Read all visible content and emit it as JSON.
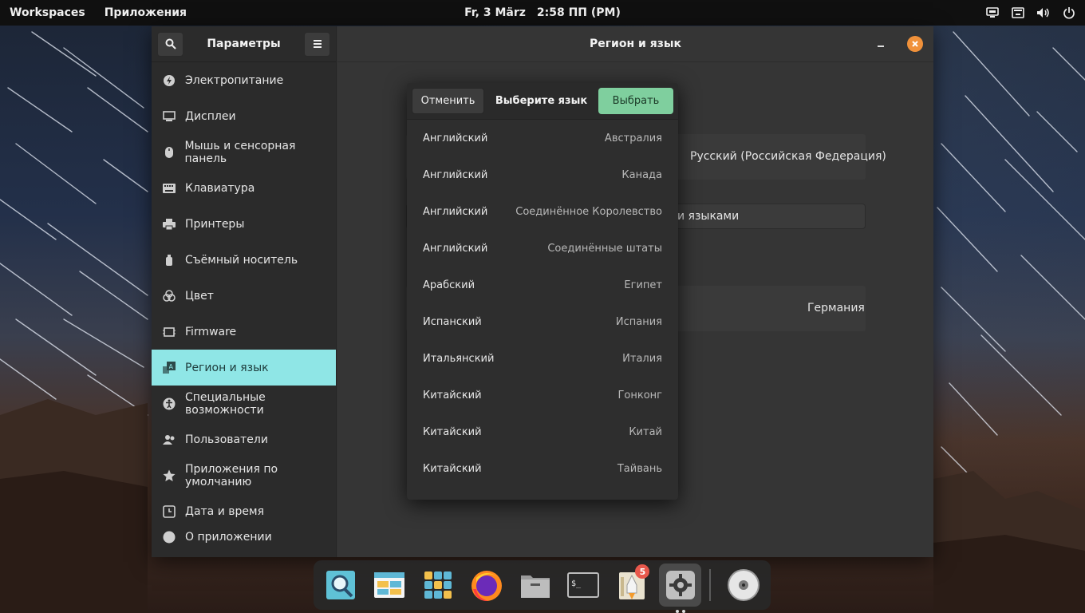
{
  "topbar": {
    "workspaces": "Workspaces",
    "applications": "Приложения",
    "date": "Fr, 3 März",
    "time": "2:58 ПП (PM)",
    "tray_icons": [
      "screen-share-icon",
      "keyboard-icon",
      "volume-icon",
      "power-icon"
    ]
  },
  "sidebar": {
    "title": "Параметры",
    "items": [
      {
        "label": "Электропитание",
        "icon": "power-icon"
      },
      {
        "label": "Дисплеи",
        "icon": "display-icon"
      },
      {
        "label": "Мышь и сенсорная панель",
        "icon": "mouse-icon"
      },
      {
        "label": "Клавиатура",
        "icon": "keyboard-icon"
      },
      {
        "label": "Принтеры",
        "icon": "printer-icon"
      },
      {
        "label": "Съёмный носитель",
        "icon": "usb-drive-icon"
      },
      {
        "label": "Цвет",
        "icon": "color-icon"
      },
      {
        "label": "Firmware",
        "icon": "chip-icon"
      },
      {
        "label": "Регион и язык",
        "icon": "language-icon",
        "active": true
      },
      {
        "label": "Специальные возможности",
        "icon": "accessibility-icon"
      },
      {
        "label": "Пользователи",
        "icon": "users-icon"
      },
      {
        "label": "Приложения по умолчанию",
        "icon": "star-icon"
      },
      {
        "label": "Дата и время",
        "icon": "clock-icon"
      },
      {
        "label": "О приложении",
        "icon": "info-icon"
      }
    ]
  },
  "content": {
    "title": "Регион и язык",
    "language_value": "Русский (Российская Федерация)",
    "manage_button": "и языками",
    "region_value": "Германия"
  },
  "popover": {
    "cancel": "Отменить",
    "title": "Выберите язык",
    "select": "Выбрать",
    "languages": [
      {
        "name": "Английский",
        "region": "Австралия"
      },
      {
        "name": "Английский",
        "region": "Канада"
      },
      {
        "name": "Английский",
        "region": "Соединённое Королевство"
      },
      {
        "name": "Английский",
        "region": "Соединённые штаты"
      },
      {
        "name": "Арабский",
        "region": "Египет"
      },
      {
        "name": "Испанский",
        "region": "Испания"
      },
      {
        "name": "Итальянский",
        "region": "Италия"
      },
      {
        "name": "Китайский",
        "region": "Гонконг"
      },
      {
        "name": "Китайский",
        "region": "Китай"
      },
      {
        "name": "Китайский",
        "region": "Тайвань"
      }
    ]
  },
  "dock": {
    "items": [
      "search-app-icon",
      "files-icon",
      "app-center-icon",
      "firefox-icon",
      "file-manager-icon",
      "terminal-icon",
      "rocket-app-icon",
      "settings-icon",
      "disk-icon"
    ],
    "badge_count": "5"
  },
  "colors": {
    "accent": "#8fe6e6",
    "select_button": "#7fcf9e",
    "close_button": "#f0913a",
    "badge": "#e8584c"
  }
}
